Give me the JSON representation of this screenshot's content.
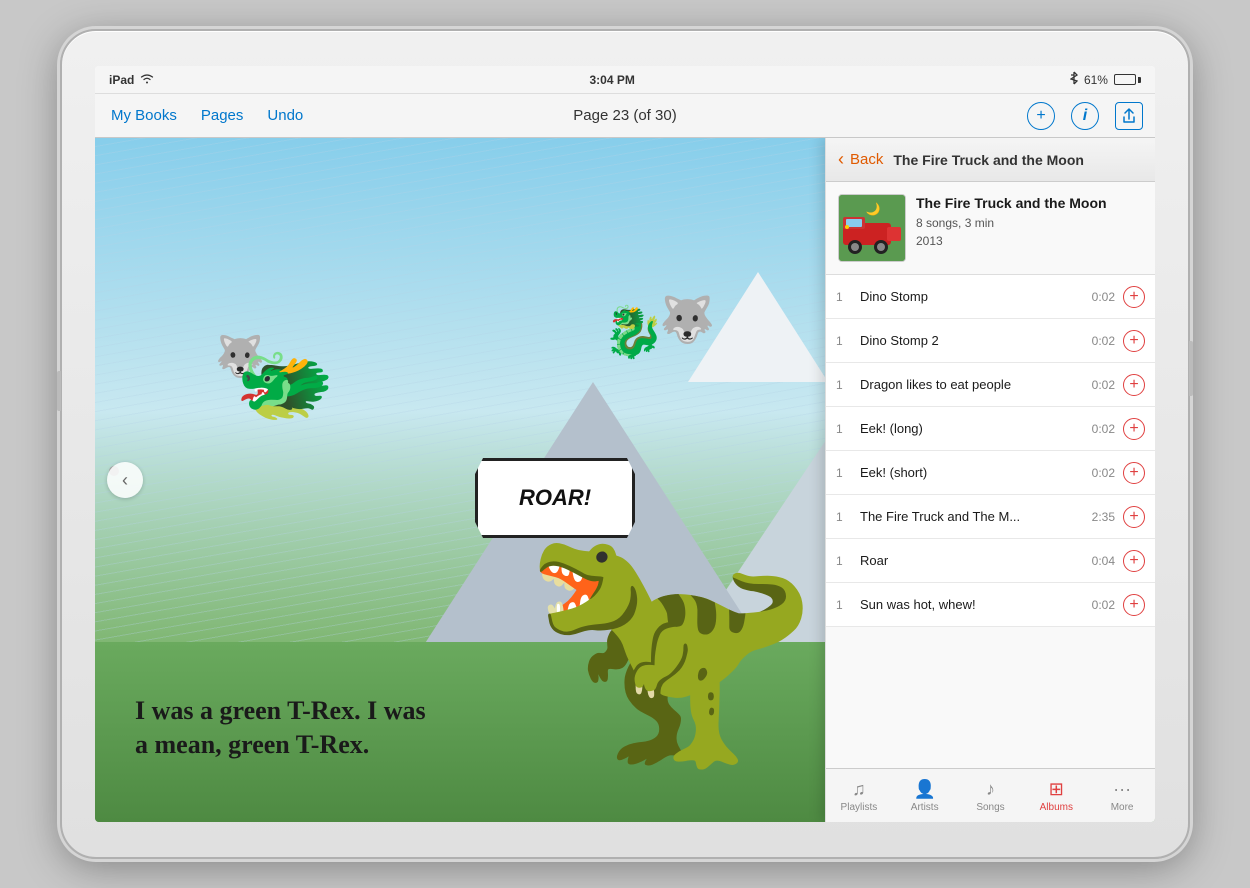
{
  "status_bar": {
    "device": "iPad",
    "wifi_icon": "wifi",
    "time": "3:04 PM",
    "bluetooth_icon": "bluetooth",
    "battery_percent": "61%"
  },
  "toolbar": {
    "my_books_label": "My Books",
    "pages_label": "Pages",
    "undo_label": "Undo",
    "page_info": "Page 23 (of 30)",
    "add_icon": "+",
    "info_icon": "i",
    "share_icon": "⬆"
  },
  "book": {
    "text_line1": "I was a green T-Rex. I was",
    "text_line2": "a mean, green T-Rex.",
    "roar": "ROAR!"
  },
  "music_panel": {
    "header": {
      "back_label": "Back",
      "title": "The Fire Truck and the Moon"
    },
    "album": {
      "title": "The Fire Truck and the Moon",
      "songs_count": "8 songs, 3 min",
      "year": "2013"
    },
    "songs": [
      {
        "track": "1",
        "name": "Dino Stomp",
        "duration": "0:02"
      },
      {
        "track": "1",
        "name": "Dino Stomp 2",
        "duration": "0:02"
      },
      {
        "track": "1",
        "name": "Dragon likes to eat people",
        "duration": "0:02"
      },
      {
        "track": "1",
        "name": "Eek! (long)",
        "duration": "0:02"
      },
      {
        "track": "1",
        "name": "Eek! (short)",
        "duration": "0:02"
      },
      {
        "track": "1",
        "name": "The Fire Truck and The M...",
        "duration": "2:35"
      },
      {
        "track": "1",
        "name": "Roar",
        "duration": "0:04"
      },
      {
        "track": "1",
        "name": "Sun was hot, whew!",
        "duration": "0:02"
      }
    ],
    "tabs": [
      {
        "id": "playlists",
        "icon": "♫",
        "label": "Playlists"
      },
      {
        "id": "artists",
        "icon": "👤",
        "label": "Artists"
      },
      {
        "id": "songs",
        "icon": "♪",
        "label": "Songs"
      },
      {
        "id": "albums",
        "icon": "⊞",
        "label": "Albums",
        "active": true
      },
      {
        "id": "more",
        "icon": "···",
        "label": "More"
      }
    ]
  }
}
